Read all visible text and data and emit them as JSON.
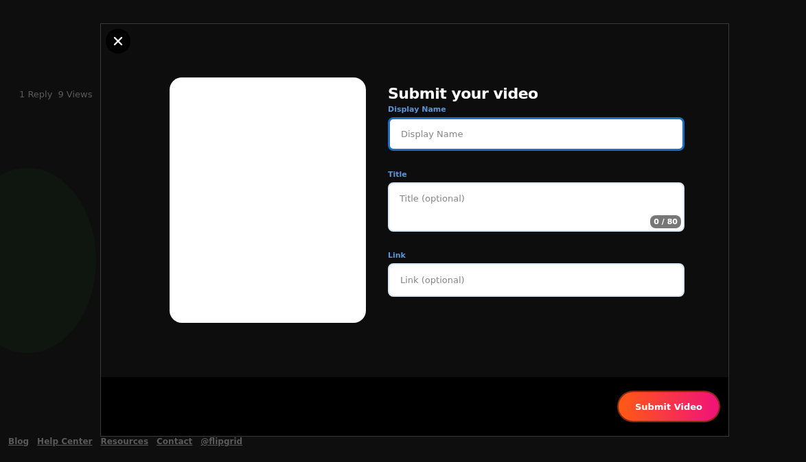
{
  "background": {
    "stats": [
      "1 Reply",
      "9 Views"
    ],
    "footer_links": [
      "Blog",
      "Help Center",
      "Resources",
      "Contact",
      "@flipgrid"
    ]
  },
  "modal": {
    "title": "Submit your video",
    "fields": [
      {
        "label": "Display Name",
        "placeholder": "Display Name",
        "kind": "input",
        "focused": true
      },
      {
        "label": "Title",
        "placeholder": "Title (optional)",
        "kind": "textarea",
        "focused": false,
        "counter": "0 / 80"
      },
      {
        "label": "Link",
        "placeholder": "Link (optional)",
        "kind": "input",
        "focused": false
      }
    ],
    "submit_button": "Submit Video"
  }
}
